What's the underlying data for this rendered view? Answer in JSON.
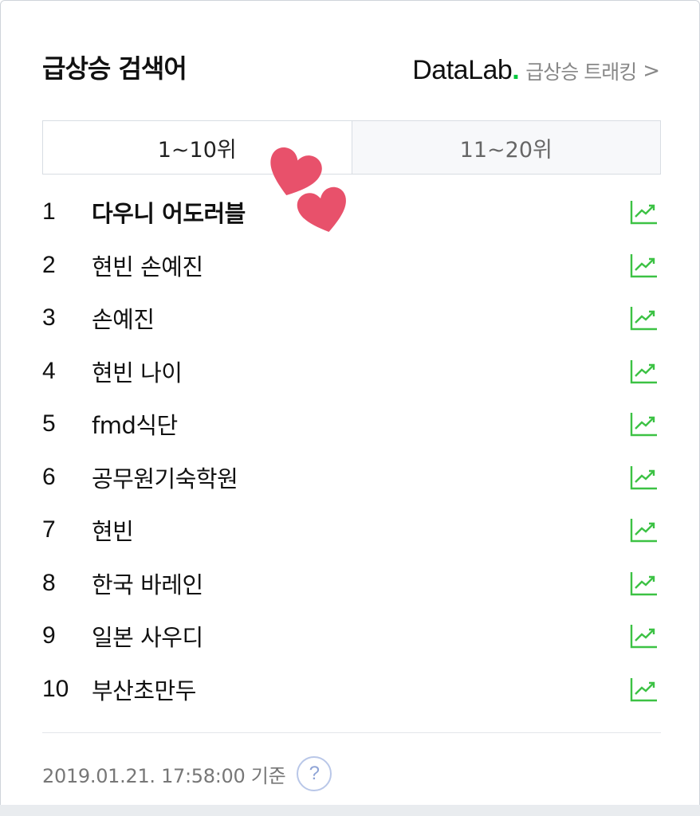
{
  "header": {
    "title": "급상승 검색어",
    "datalab_logo": "DataLab",
    "datalab_dot": ".",
    "tracking_link": "급상승 트래킹",
    "chevron": ">"
  },
  "tabs": [
    {
      "label": "1~10위",
      "active": true
    },
    {
      "label": "11~20위",
      "active": false
    }
  ],
  "rankings": [
    {
      "rank": "1",
      "keyword": "다우니 어도러블"
    },
    {
      "rank": "2",
      "keyword": "현빈 손예진"
    },
    {
      "rank": "3",
      "keyword": "손예진"
    },
    {
      "rank": "4",
      "keyword": "현빈 나이"
    },
    {
      "rank": "5",
      "keyword": "fmd식단"
    },
    {
      "rank": "6",
      "keyword": "공무원기숙학원"
    },
    {
      "rank": "7",
      "keyword": "현빈"
    },
    {
      "rank": "8",
      "keyword": "한국 바레인"
    },
    {
      "rank": "9",
      "keyword": "일본 사우디"
    },
    {
      "rank": "10",
      "keyword": "부산초만두"
    }
  ],
  "footer": {
    "timestamp": "2019.01.21. 17:58:00 기준",
    "help_icon": "?"
  },
  "icons": {
    "trend": "trend-chart-icon",
    "stickers": "heart-sticker-icon"
  },
  "colors": {
    "trend_green": "#3cc244",
    "datalab_green": "#00c73c",
    "heart": "#e8516b"
  }
}
